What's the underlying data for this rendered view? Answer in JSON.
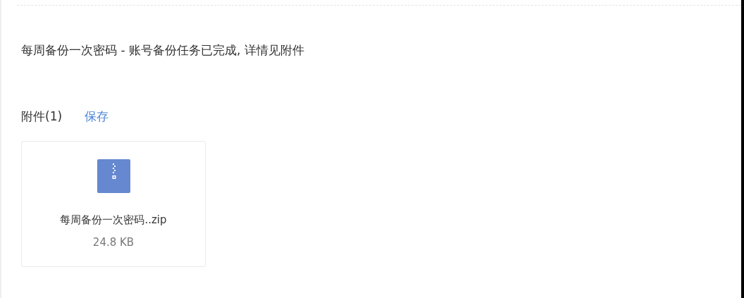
{
  "message": {
    "body": "每周备份一次密码 - 账号备份任务已完成, 详情见附件"
  },
  "attachments": {
    "heading": "附件(1)",
    "save_link": "保存",
    "files": [
      {
        "kind": "zip",
        "name": "每周备份一次密码..zip",
        "size": "24.8 KB"
      }
    ]
  }
}
